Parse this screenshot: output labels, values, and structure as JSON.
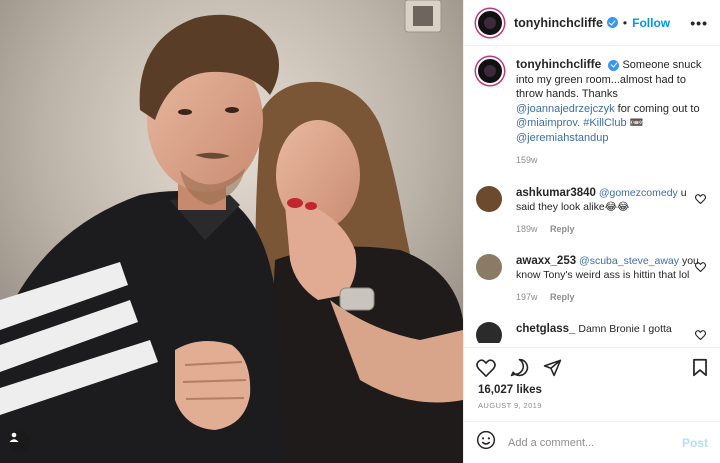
{
  "post": {
    "username": "tonyhinchcliffe",
    "follow_label": "Follow",
    "more_label": "•••",
    "caption": {
      "username": "tonyhinchcliffe",
      "text_1": "Someone snuck into my green room...almost had to throw hands. Thanks",
      "mention_1": "@joannajedrzejczyk",
      "text_2": "for coming out to",
      "mention_2": "@miaimprov.",
      "hashtag": "#KillClub",
      "emoji": "📼",
      "mention_3": "@jeremiahstandup",
      "age": "159w"
    },
    "comments": [
      {
        "username": "ashkumar3840",
        "mention": "@gomezcomedy",
        "text": "u said they look alike😂😂",
        "age": "189w",
        "reply_label": "Reply",
        "avatar_color": "#6b4a2e"
      },
      {
        "username": "awaxx_253",
        "mention": "@scuba_steve_away",
        "text": "you know Tony's weird ass is hittin that lol",
        "age": "197w",
        "reply_label": "Reply",
        "avatar_color": "#8a7a66"
      },
      {
        "username": "chetglass_",
        "mention": "",
        "text": "Damn Bronie I gotta",
        "age": "",
        "reply_label": "",
        "avatar_color": "#2b2b2b"
      }
    ],
    "likes": "16,027 likes",
    "date": "AUGUST 9, 2019",
    "add_comment_placeholder": "Add a comment...",
    "post_label": "Post"
  },
  "colors": {
    "verified": "#3897f0",
    "follow": "#0095f6",
    "mention": "#3d6ea8",
    "post_disabled": "#b2dffc"
  },
  "icons": [
    "user-tag-icon",
    "verified-icon",
    "heart-icon",
    "comment-icon",
    "share-icon",
    "bookmark-icon",
    "emoji-icon"
  ]
}
